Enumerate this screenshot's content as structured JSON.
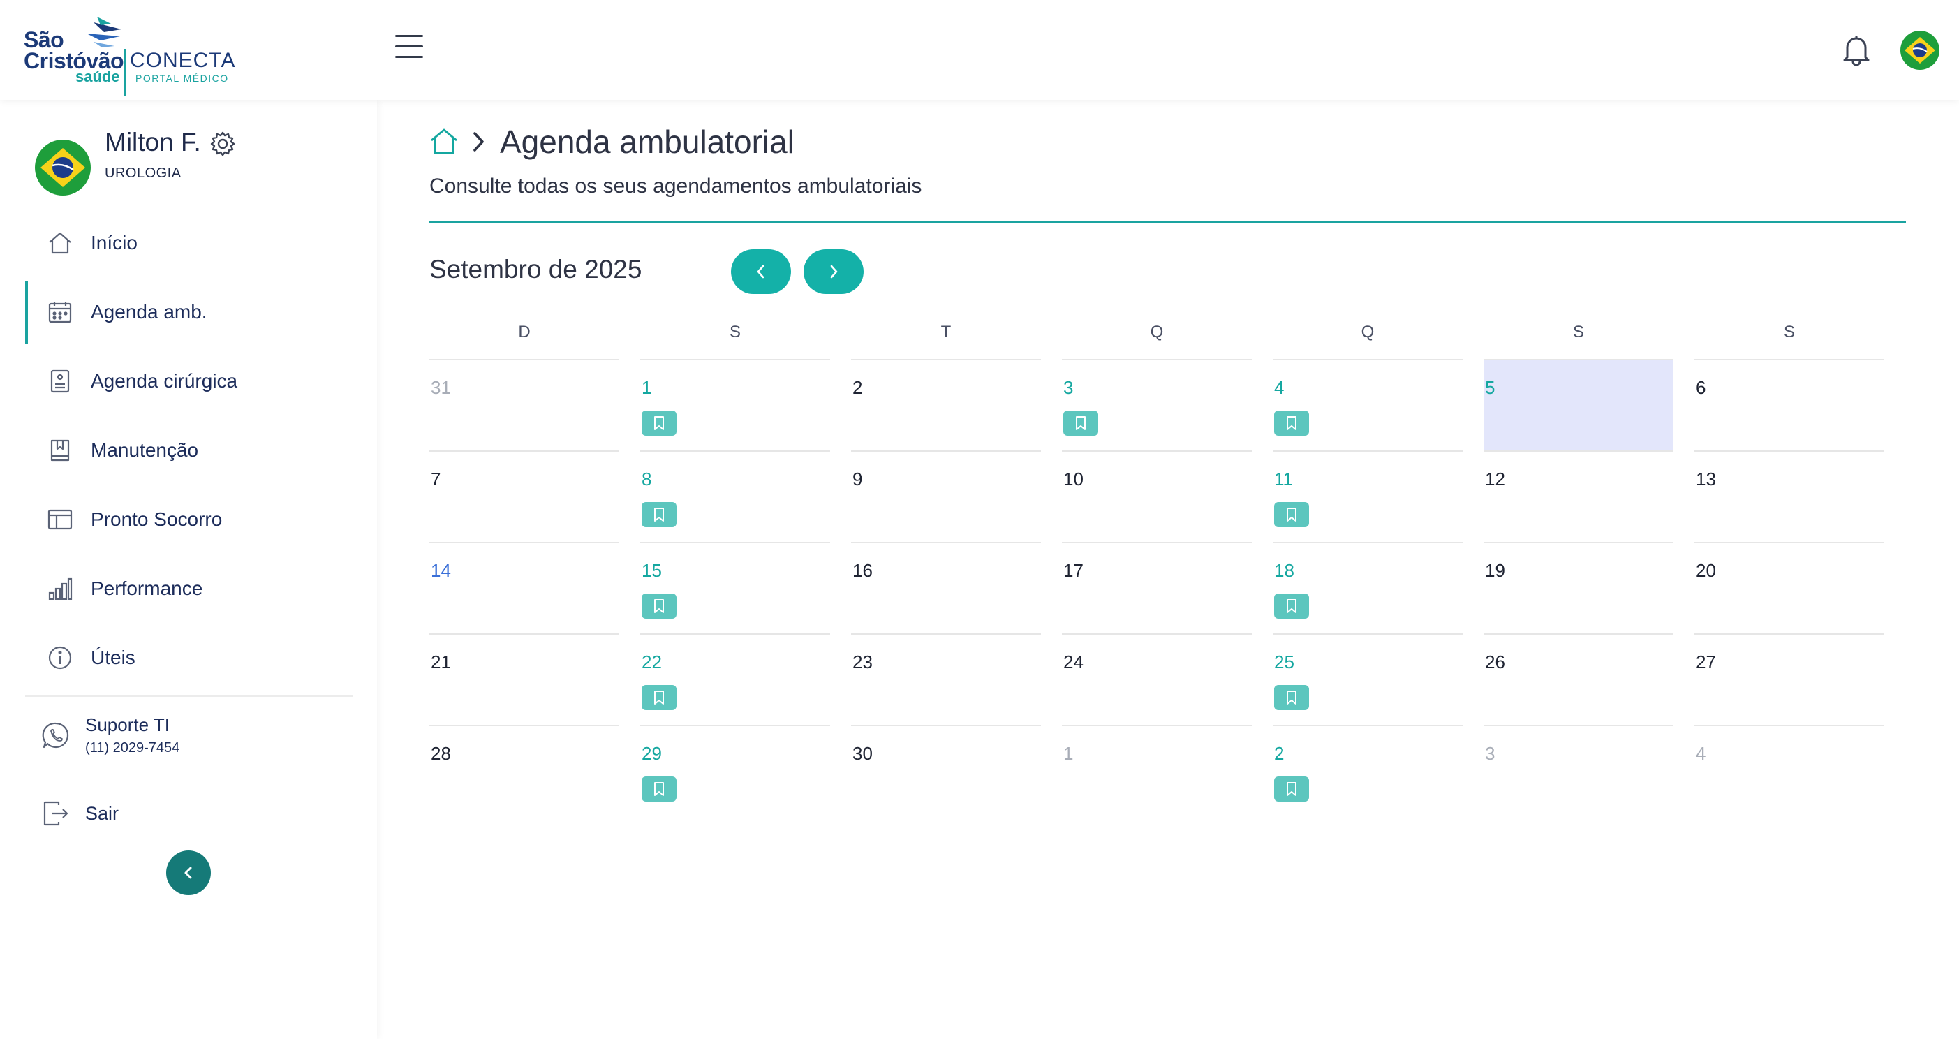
{
  "header": {
    "logo": {
      "line1": "São",
      "line2": "Cristóvão",
      "line3": "saúde",
      "conecta": "CONECTA",
      "portal": "PORTAL MÉDICO"
    },
    "icons": [
      "menu-icon",
      "bell-icon",
      "brazil-flag-icon"
    ]
  },
  "profile": {
    "name": "Milton F.",
    "specialty": "UROLOGIA"
  },
  "sidebar": {
    "items": [
      {
        "label": "Início",
        "icon": "home-icon"
      },
      {
        "label": "Agenda amb.",
        "icon": "calendar-icon",
        "active": true
      },
      {
        "label": "Agenda cirúrgica",
        "icon": "clipboard-icon"
      },
      {
        "label": "Manutenção",
        "icon": "book-icon"
      },
      {
        "label": "Pronto Socorro",
        "icon": "layout-icon"
      },
      {
        "label": "Performance",
        "icon": "bar-chart-icon"
      },
      {
        "label": "Úteis",
        "icon": "info-icon"
      }
    ],
    "support": {
      "label": "Suporte TI",
      "phone": "(11) 2029-7454"
    },
    "logout": {
      "label": "Sair"
    }
  },
  "page": {
    "title": "Agenda ambulatorial",
    "subtitle": "Consulte todas os seus agendamentos ambulatoriais"
  },
  "calendar": {
    "month_label": "Setembro de 2025",
    "weekdays": [
      "D",
      "S",
      "T",
      "Q",
      "Q",
      "S",
      "S"
    ],
    "weeks": [
      [
        {
          "d": "31",
          "s": "muted"
        },
        {
          "d": "1",
          "s": "teal",
          "b": true
        },
        {
          "d": "2",
          "s": "dark"
        },
        {
          "d": "3",
          "s": "teal",
          "b": true
        },
        {
          "d": "4",
          "s": "teal",
          "b": true
        },
        {
          "d": "5",
          "s": "teal",
          "today": true
        },
        {
          "d": "6",
          "s": "dark"
        }
      ],
      [
        {
          "d": "7",
          "s": "dark"
        },
        {
          "d": "8",
          "s": "teal",
          "b": true
        },
        {
          "d": "9",
          "s": "dark"
        },
        {
          "d": "10",
          "s": "dark"
        },
        {
          "d": "11",
          "s": "teal",
          "b": true
        },
        {
          "d": "12",
          "s": "dark"
        },
        {
          "d": "13",
          "s": "dark"
        }
      ],
      [
        {
          "d": "14",
          "s": "blue"
        },
        {
          "d": "15",
          "s": "teal",
          "b": true
        },
        {
          "d": "16",
          "s": "dark"
        },
        {
          "d": "17",
          "s": "dark"
        },
        {
          "d": "18",
          "s": "teal",
          "b": true
        },
        {
          "d": "19",
          "s": "dark"
        },
        {
          "d": "20",
          "s": "dark"
        }
      ],
      [
        {
          "d": "21",
          "s": "dark"
        },
        {
          "d": "22",
          "s": "teal",
          "b": true
        },
        {
          "d": "23",
          "s": "dark"
        },
        {
          "d": "24",
          "s": "dark"
        },
        {
          "d": "25",
          "s": "teal",
          "b": true
        },
        {
          "d": "26",
          "s": "dark"
        },
        {
          "d": "27",
          "s": "dark"
        }
      ],
      [
        {
          "d": "28",
          "s": "dark"
        },
        {
          "d": "29",
          "s": "teal",
          "b": true
        },
        {
          "d": "30",
          "s": "dark"
        },
        {
          "d": "1",
          "s": "muted"
        },
        {
          "d": "2",
          "s": "teal",
          "b": true
        },
        {
          "d": "3",
          "s": "muted"
        },
        {
          "d": "4",
          "s": "muted"
        }
      ]
    ]
  },
  "colors": {
    "accent": "#14b1a8",
    "brand_navy": "#1c3a78",
    "today_bg": "#e3e6fb",
    "bookmark_bg": "#5cc6be"
  }
}
